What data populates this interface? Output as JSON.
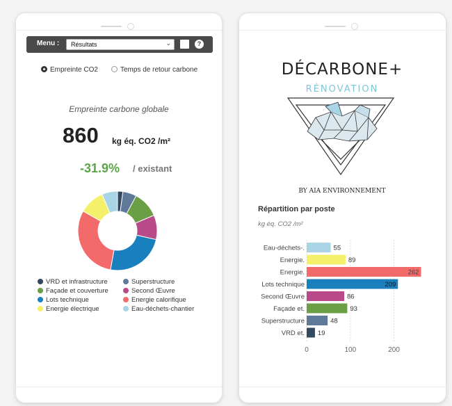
{
  "left": {
    "menu": {
      "label": "Menu :",
      "selected": "Résultats",
      "help_glyph": "?"
    },
    "radios": [
      {
        "label": "Empreinte CO2",
        "selected": true
      },
      {
        "label": "Temps de retour carbone",
        "selected": false
      }
    ],
    "subtitle": "Empreinte carbone globale",
    "total_value": "860",
    "total_unit": "kg éq. CO2 /m²",
    "delta_value": "-31.9%",
    "delta_label": "/ existant",
    "legend": [
      {
        "label": "VRD et infrastructure",
        "color": "#34495e"
      },
      {
        "label": "Superstructure",
        "color": "#5f7a99"
      },
      {
        "label": "Façade et couverture",
        "color": "#6a9f45"
      },
      {
        "label": "Second Œuvre",
        "color": "#b84a8a"
      },
      {
        "label": "Lots technique",
        "color": "#1a7fbd"
      },
      {
        "label": "Energie calorifique",
        "color": "#f26a6a"
      },
      {
        "label": "Energie électrique",
        "color": "#f5f06a"
      },
      {
        "label": "Eau-déchets-chantier",
        "color": "#a8d4e6"
      }
    ]
  },
  "right": {
    "logo": {
      "line1": "DÉCARBONE+",
      "line2": "RÉNOVATION",
      "byline": "BY AIA ENVIRONNEMENT"
    },
    "chart_title": "Répartition par poste",
    "chart_unit": "kg éq. CO2 /m²"
  },
  "chart_data": {
    "type": "bar",
    "orientation": "horizontal",
    "categories": [
      "Eau-déchets-.",
      "Energie.",
      "Energie.",
      "Lots technique",
      "Second Œuvre",
      "Façade et.",
      "Superstructure",
      "VRD et."
    ],
    "values": [
      55,
      89,
      262,
      209,
      86,
      93,
      48,
      19
    ],
    "colors": [
      "#a8d4e6",
      "#f5f06a",
      "#f26a6a",
      "#1a7fbd",
      "#b84a8a",
      "#6a9f45",
      "#5f7a99",
      "#34495e"
    ],
    "xticks": [
      0,
      100,
      200
    ],
    "xlim": [
      0,
      262
    ],
    "title": "Répartition par poste",
    "xlabel": "",
    "ylabel": "kg éq. CO2 /m²",
    "grid": true
  }
}
